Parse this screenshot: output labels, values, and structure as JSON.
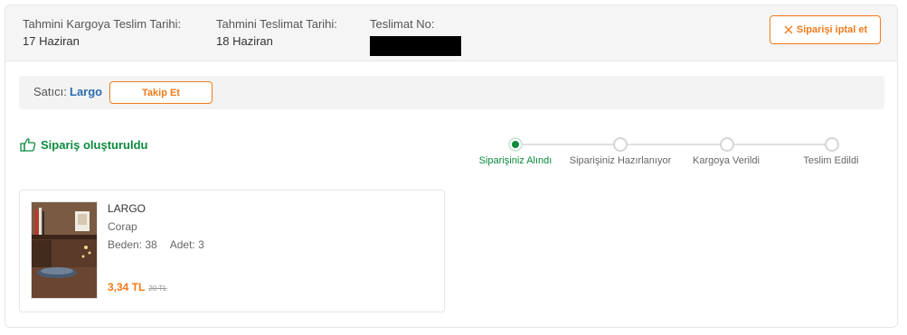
{
  "header": {
    "cargo_date_label": "Tahmini Kargoya Teslim Tarihi:",
    "cargo_date_value": "17 Haziran",
    "delivery_date_label": "Tahmini Teslimat Tarihi:",
    "delivery_date_value": "18 Haziran",
    "delivery_no_label": "Teslimat No:",
    "cancel_label": "Siparişi iptal et"
  },
  "seller": {
    "label": "Satıcı:",
    "name": "Largo",
    "follow_label": "Takip Et"
  },
  "status": {
    "text": "Sipariş oluşturuldu"
  },
  "steps": [
    {
      "label": "Siparişiniz Alındı",
      "active": true
    },
    {
      "label": "Siparişiniz Hazırlanıyor",
      "active": false
    },
    {
      "label": "Kargoya Verildi",
      "active": false
    },
    {
      "label": "Teslim Edildi",
      "active": false
    }
  ],
  "product": {
    "brand": "LARGO",
    "name": "Corap",
    "size": "Beden: 38",
    "quantity": "Adet: 3",
    "price": "3,34 TL",
    "old_price": "20 TL"
  },
  "colors": {
    "accent": "#f27a1a",
    "success": "#0b8a3e",
    "link": "#2b6cb0"
  },
  "icons": {
    "cancel": "close-icon",
    "status": "thumbs-up-icon"
  }
}
